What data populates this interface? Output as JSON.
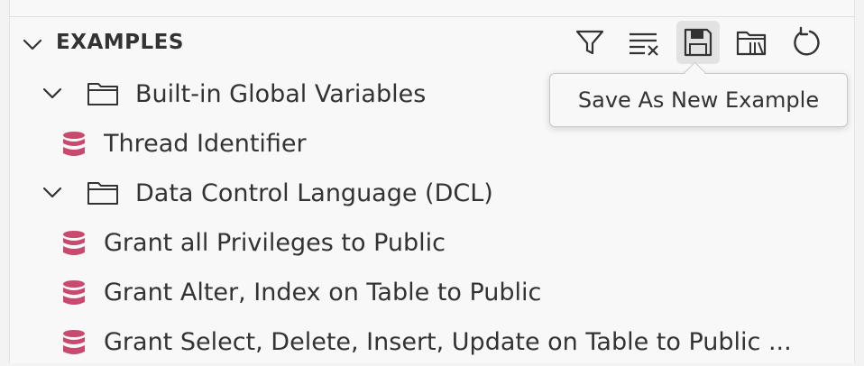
{
  "section": {
    "title": "EXAMPLES"
  },
  "toolbar": {
    "buttons": [
      {
        "name": "filter",
        "icon": "filter-icon"
      },
      {
        "name": "clear-filter",
        "icon": "clear-filter-icon"
      },
      {
        "name": "save-as-new-example",
        "icon": "save-icon",
        "active": true
      },
      {
        "name": "open-folder",
        "icon": "folder-library-icon"
      },
      {
        "name": "refresh",
        "icon": "refresh-icon"
      }
    ]
  },
  "tooltip": {
    "text": "Save As New Example"
  },
  "tree": {
    "folders": [
      {
        "label": "Built-in Global Variables",
        "items": [
          {
            "label": "Thread Identifier"
          }
        ]
      },
      {
        "label": "Data Control Language (DCL)",
        "items": [
          {
            "label": "Grant all Privileges to Public"
          },
          {
            "label": "Grant Alter, Index on Table to Public"
          },
          {
            "label": "Grant Select, Delete, Insert, Update on Table to Public ..."
          }
        ]
      }
    ]
  },
  "colors": {
    "database_icon": "#c84a6e",
    "text": "#333333",
    "active_button_bg": "#e2e2e2",
    "panel_bg": "#f8f8f8"
  }
}
